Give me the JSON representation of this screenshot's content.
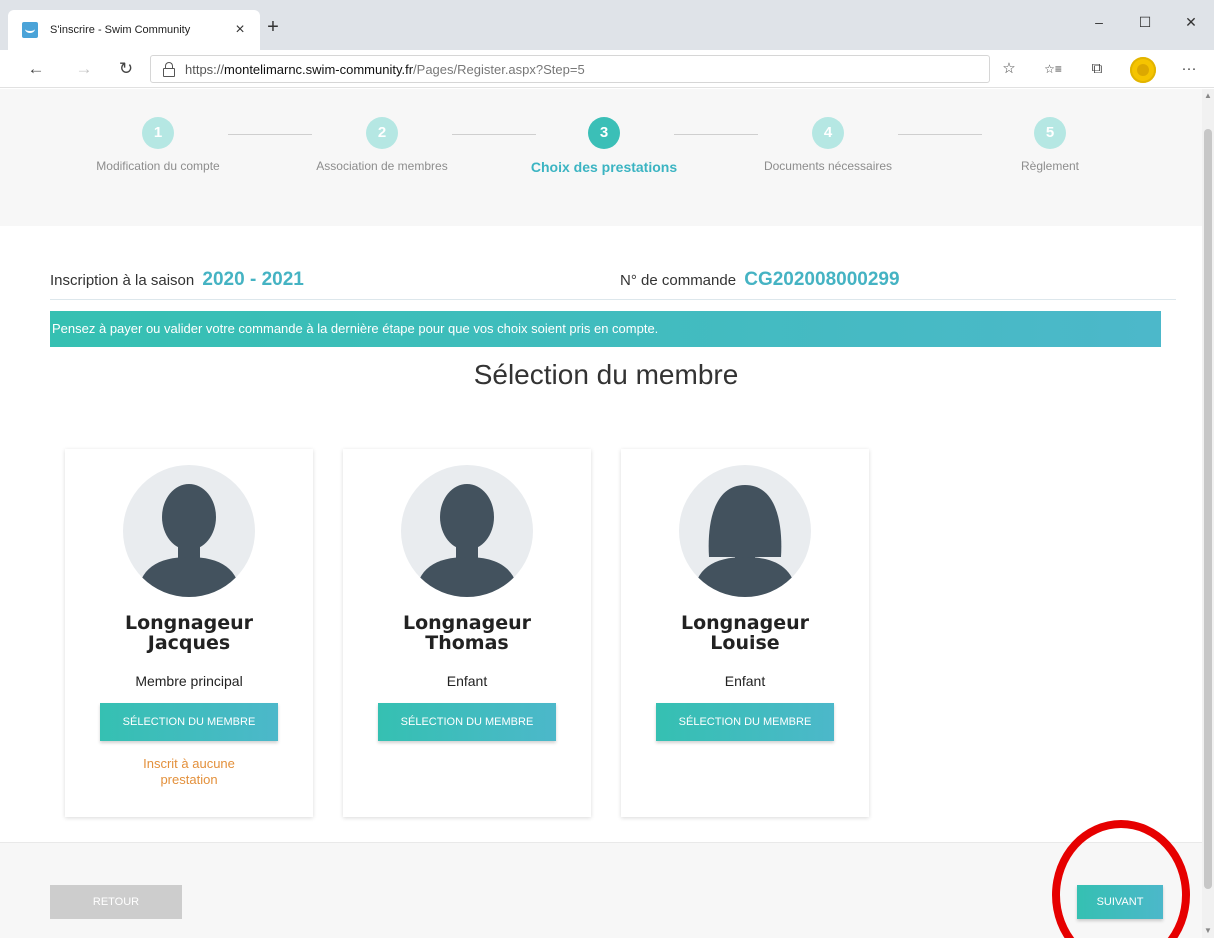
{
  "browser": {
    "tab_title": "S'inscrire - Swim Community",
    "tab_close": "×",
    "new_tab": "+",
    "url_prefix": "https://",
    "url_host": "montelimarnc.swim-community.fr",
    "url_path": "/Pages/Register.aspx?Step=5",
    "window_buttons": {
      "minimize": "–",
      "maximize": "☐",
      "close": "✕"
    },
    "nav": {
      "back": "←",
      "forward": "→",
      "refresh": "↻"
    },
    "tools": {
      "favorite": "☆",
      "favorites_list": "☆≡",
      "collections": "⧉",
      "more": "···"
    }
  },
  "stepper": {
    "steps": [
      {
        "number": "1",
        "label": "Modification du compte"
      },
      {
        "number": "2",
        "label": "Association de membres"
      },
      {
        "number": "3",
        "label": "Choix des prestations"
      },
      {
        "number": "4",
        "label": "Documents nécessaires"
      },
      {
        "number": "5",
        "label": "Règlement"
      }
    ],
    "active_step": 3
  },
  "header": {
    "season_label": "Inscription à la saison",
    "season_value": "2020 - 2021",
    "order_label": "N° de commande",
    "order_value": "CG202008000299"
  },
  "alert": {
    "text": "Pensez à payer ou valider votre commande à la dernière étape pour que vos choix soient pris en compte."
  },
  "section": {
    "title": "Sélection du membre"
  },
  "members": [
    {
      "last_name": "Longnageur",
      "first_name": "Jacques",
      "role": "Membre principal",
      "button": "SÉLECTION DU MEMBRE",
      "note": "Inscrit à aucune prestation",
      "avatar": "male-avatar-icon"
    },
    {
      "last_name": "Longnageur",
      "first_name": "Thomas",
      "role": "Enfant",
      "button": "SÉLECTION DU MEMBRE",
      "note": "",
      "avatar": "male-avatar-icon"
    },
    {
      "last_name": "Longnageur",
      "first_name": "Louise",
      "role": "Enfant",
      "button": "SÉLECTION DU MEMBRE",
      "note": "",
      "avatar": "female-avatar-icon"
    }
  ],
  "footer": {
    "back_label": "RETOUR",
    "next_label": "SUIVANT"
  },
  "colors": {
    "accent": "#3bbfb7",
    "accent_light": "#b5e7e3",
    "note": "#e3903b",
    "annotation": "#e60000"
  }
}
